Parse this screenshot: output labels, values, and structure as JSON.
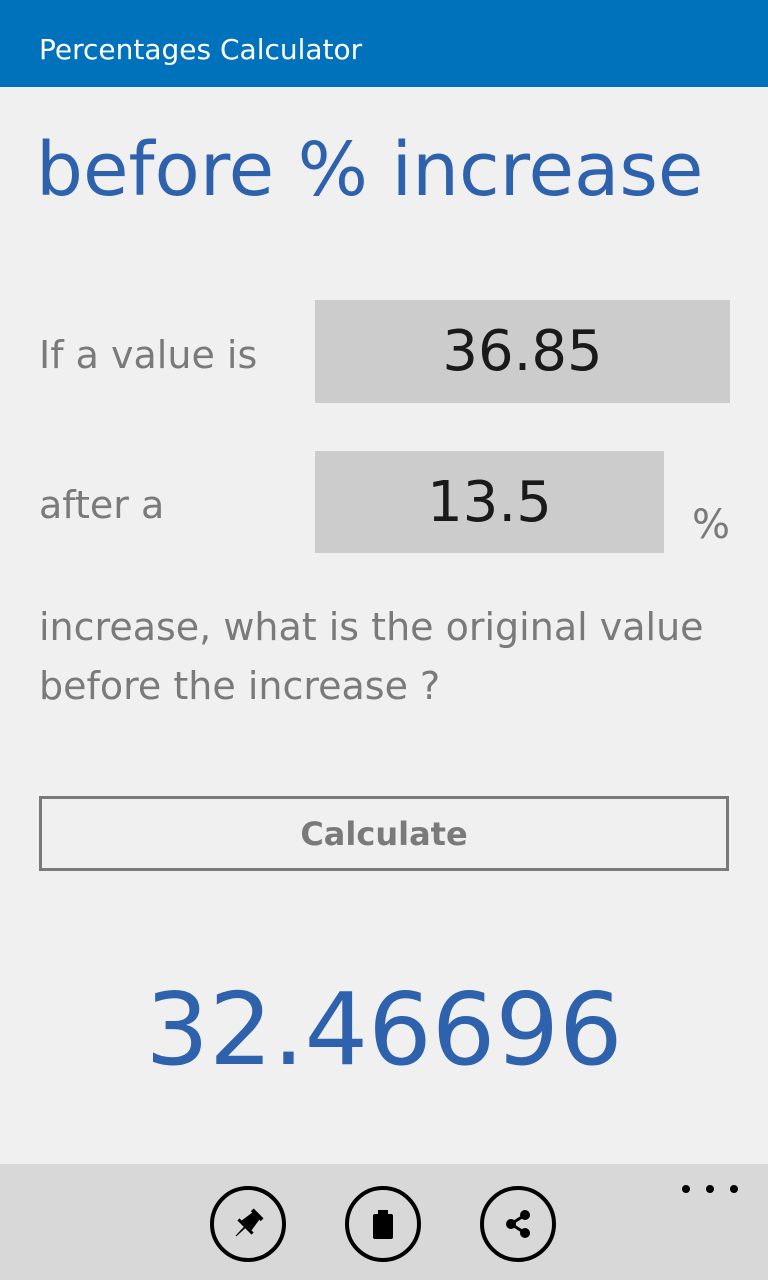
{
  "app": {
    "title": "Percentages Calculator"
  },
  "page": {
    "title": "before % increase"
  },
  "form": {
    "value_label": "If a value is",
    "value_input": "36.85",
    "percent_label": "after a",
    "percent_input": "13.5",
    "percent_symbol": "%",
    "question": "increase, what is the original value before the increase ?",
    "calculate_label": "Calculate"
  },
  "result": {
    "value": "32.46696"
  },
  "appbar": {
    "buttons": [
      {
        "icon": "pin-icon"
      },
      {
        "icon": "clipboard-icon"
      },
      {
        "icon": "share-icon"
      }
    ],
    "more_icon": "more-icon"
  }
}
